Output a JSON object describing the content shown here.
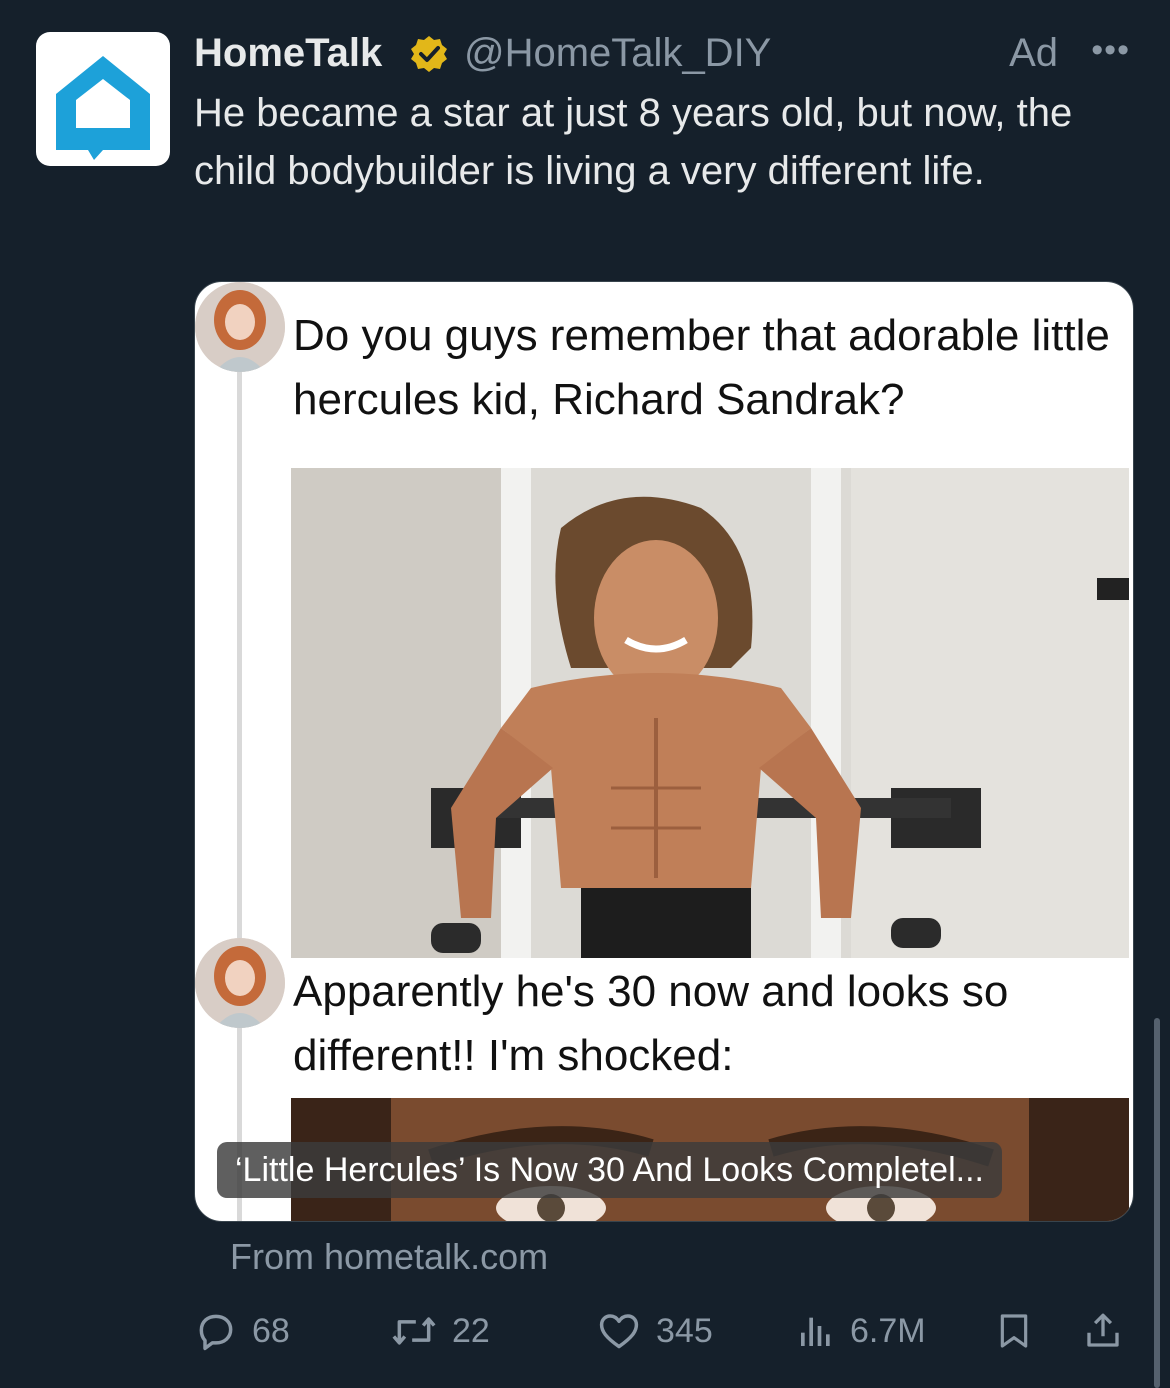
{
  "tweet": {
    "author": "HomeTalk",
    "handle": "@HomeTalk_DIY",
    "ad_label": "Ad",
    "more_label": "•••",
    "text": "He became a star at just 8 years old, but now, the child bodybuilder is living a very different life."
  },
  "card": {
    "post1": "Do you guys remember that adorable little hercules kid, Richard Sandrak?",
    "post2": "Apparently he's 30 now and looks so different!! I'm shocked:",
    "caption": "‘Little Hercules’ Is Now 30 And Looks Completel...",
    "source": "From hometalk.com"
  },
  "actions": {
    "replies": "68",
    "reposts": "22",
    "likes": "345",
    "views": "6.7M"
  },
  "colors": {
    "background": "#15202b",
    "brand": "#1da1d9",
    "verified": "#e2b719",
    "muted": "#8b98a5"
  },
  "icons": [
    "hometalk-logo-icon",
    "verified-badge-icon",
    "reply-icon",
    "repost-icon",
    "like-icon",
    "views-icon",
    "bookmark-icon",
    "share-icon"
  ]
}
